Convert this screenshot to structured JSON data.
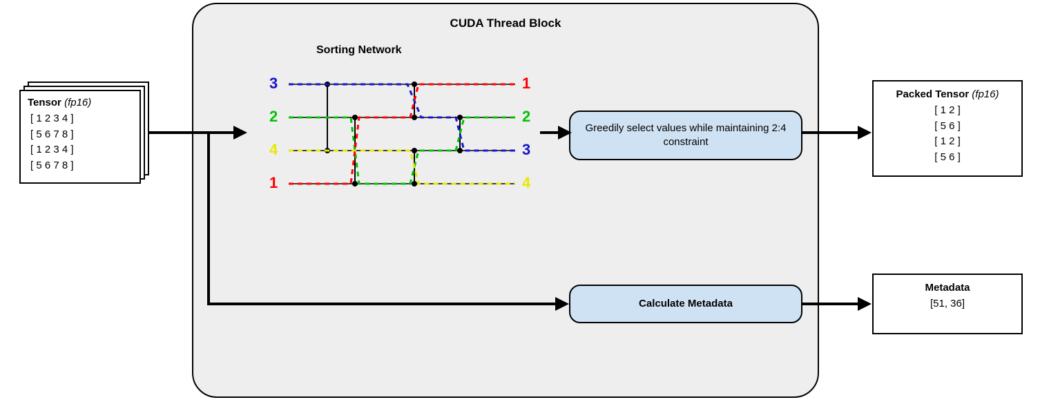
{
  "thread_block_title": "CUDA Thread Block",
  "input_tensor": {
    "title_bold": "Tensor",
    "title_type": "(fp16)",
    "rows": [
      "[ 1 2 3 4 ]",
      "[ 5 6 7 8 ]",
      "[ 1 2 3 4 ]",
      "[ 5 6 7 8 ]"
    ]
  },
  "sorting_network": {
    "label": "Sorting Network",
    "left_numbers": [
      "3",
      "2",
      "4",
      "1"
    ],
    "right_numbers": [
      "1",
      "2",
      "3",
      "4"
    ],
    "left_colors": [
      "blue",
      "green",
      "yellow",
      "red"
    ],
    "right_colors": [
      "red",
      "green",
      "blue",
      "yellow"
    ]
  },
  "greedy_label": "Greedily select values while maintaining 2:4 constraint",
  "metadata_proc_label": "Calculate Metadata",
  "packed_tensor": {
    "title_bold": "Packed Tensor",
    "title_type": "(fp16)",
    "rows": [
      "[ 1 2 ]",
      "[ 5 6 ]",
      "[ 1 2 ]",
      "[ 5 6 ]"
    ]
  },
  "metadata_out": {
    "title": "Metadata",
    "value": "[51, 36]"
  }
}
